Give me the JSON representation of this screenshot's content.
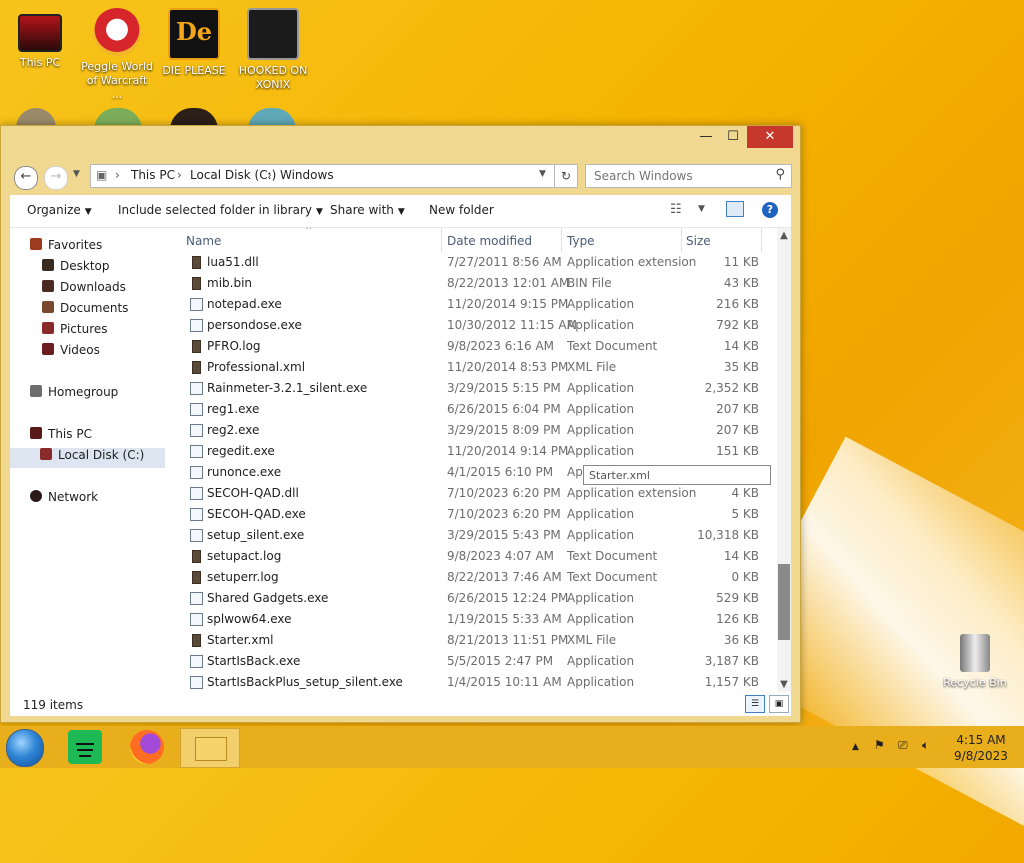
{
  "desktop": {
    "icons": [
      {
        "label": "This PC"
      },
      {
        "label": "Peggle World of Warcraft ..."
      },
      {
        "label": "DIE PLEASE"
      },
      {
        "label": "HOOKED ON XONIX"
      },
      {
        "label": "Recycle Bin"
      }
    ]
  },
  "window": {
    "controls": {
      "minimize": "—",
      "maximize": "☐",
      "close": "✕"
    }
  },
  "addressbar": {
    "back": "←",
    "forward": "→",
    "breadcrumb": [
      "This PC",
      "Local Disk (C:)",
      "Windows"
    ],
    "search_placeholder": "Search Windows"
  },
  "toolbar": {
    "organize": "Organize",
    "include_in_library": "Include selected folder in library",
    "share_with": "Share with",
    "new_folder": "New folder"
  },
  "navpane": {
    "favorites": "Favorites",
    "desktop": "Desktop",
    "downloads": "Downloads",
    "documents": "Documents",
    "pictures": "Pictures",
    "videos": "Videos",
    "homegroup": "Homegroup",
    "this_pc": "This PC",
    "local_disk": "Local Disk (C:)",
    "network": "Network"
  },
  "filelist": {
    "columns": {
      "name": "Name",
      "date": "Date modified",
      "type": "Type",
      "size": "Size"
    },
    "rows": [
      {
        "name": "lua51.dll",
        "date": "7/27/2011 8:56 AM",
        "type": "Application extension",
        "size": "11 KB",
        "icon": "doc"
      },
      {
        "name": "mib.bin",
        "date": "8/22/2013 12:01 AM",
        "type": "BIN File",
        "size": "43 KB",
        "icon": "doc"
      },
      {
        "name": "notepad.exe",
        "date": "11/20/2014 9:15 PM",
        "type": "Application",
        "size": "216 KB",
        "icon": "app"
      },
      {
        "name": "persondose.exe",
        "date": "10/30/2012 11:15 AM",
        "type": "Application",
        "size": "792 KB",
        "icon": "app"
      },
      {
        "name": "PFRO.log",
        "date": "9/8/2023 6:16 AM",
        "type": "Text Document",
        "size": "14 KB",
        "icon": "doc"
      },
      {
        "name": "Professional.xml",
        "date": "11/20/2014 8:53 PM",
        "type": "XML File",
        "size": "35 KB",
        "icon": "doc"
      },
      {
        "name": "Rainmeter-3.2.1_silent.exe",
        "date": "3/29/2015 5:15 PM",
        "type": "Application",
        "size": "2,352 KB",
        "icon": "app"
      },
      {
        "name": "reg1.exe",
        "date": "6/26/2015 6:04 PM",
        "type": "Application",
        "size": "207 KB",
        "icon": "app"
      },
      {
        "name": "reg2.exe",
        "date": "3/29/2015 8:09 PM",
        "type": "Application",
        "size": "207 KB",
        "icon": "app"
      },
      {
        "name": "regedit.exe",
        "date": "11/20/2014 9:14 PM",
        "type": "Application",
        "size": "151 KB",
        "icon": "app"
      },
      {
        "name": "runonce.exe",
        "date": "4/1/2015 6:10 PM",
        "type": "Ap",
        "size": "",
        "icon": "app"
      },
      {
        "name": "SECOH-QAD.dll",
        "date": "7/10/2023 6:20 PM",
        "type": "Application extension",
        "size": "4 KB",
        "icon": "app"
      },
      {
        "name": "SECOH-QAD.exe",
        "date": "7/10/2023 6:20 PM",
        "type": "Application",
        "size": "5 KB",
        "icon": "app"
      },
      {
        "name": "setup_silent.exe",
        "date": "3/29/2015 5:43 PM",
        "type": "Application",
        "size": "10,318 KB",
        "icon": "app"
      },
      {
        "name": "setupact.log",
        "date": "9/8/2023 4:07 AM",
        "type": "Text Document",
        "size": "14 KB",
        "icon": "doc"
      },
      {
        "name": "setuperr.log",
        "date": "8/22/2013 7:46 AM",
        "type": "Text Document",
        "size": "0 KB",
        "icon": "doc"
      },
      {
        "name": "Shared Gadgets.exe",
        "date": "6/26/2015 12:24 PM",
        "type": "Application",
        "size": "529 KB",
        "icon": "app"
      },
      {
        "name": "splwow64.exe",
        "date": "1/19/2015 5:33 AM",
        "type": "Application",
        "size": "126 KB",
        "icon": "app"
      },
      {
        "name": "Starter.xml",
        "date": "8/21/2013 11:51 PM",
        "type": "XML File",
        "size": "36 KB",
        "icon": "doc"
      },
      {
        "name": "StartIsBack.exe",
        "date": "5/5/2015 2:47 PM",
        "type": "Application",
        "size": "3,187 KB",
        "icon": "app"
      },
      {
        "name": "StartIsBackPlus_setup_silent.exe",
        "date": "1/4/2015 10:11 AM",
        "type": "Application",
        "size": "1,157 KB",
        "icon": "app"
      }
    ],
    "tooltip": "Starter.xml"
  },
  "statusbar": {
    "item_count": "119 items"
  },
  "taskbar": {
    "clock_time": "4:15 AM",
    "clock_date": "9/8/2023"
  },
  "colors": {
    "wallpaper": "#f5b300",
    "window_frame": "#f0d890",
    "close_button": "#c7382c",
    "taskbar": "#e8ae1c"
  }
}
